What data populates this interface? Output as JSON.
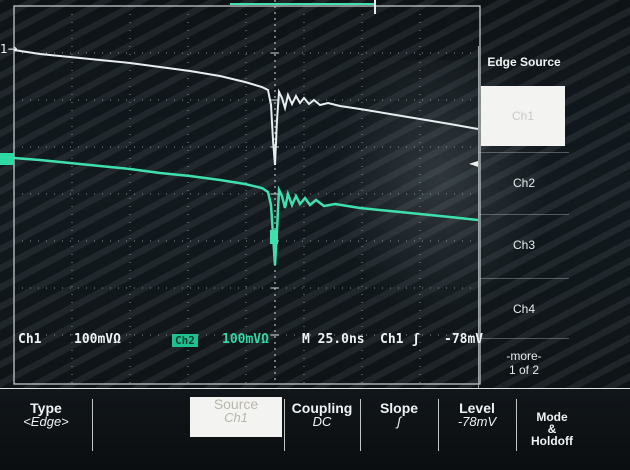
{
  "side_menu": {
    "header": "Edge Source",
    "buttons": [
      {
        "label": "Ch1",
        "active": true
      },
      {
        "label": "Ch2",
        "active": false
      },
      {
        "label": "Ch3",
        "active": false
      },
      {
        "label": "Ch4",
        "active": false
      }
    ],
    "more_line1": "-more-",
    "more_line2": "1 of 2"
  },
  "status": {
    "ch1_label": "Ch1",
    "ch1_scale": "100mVΩ",
    "ch2_badge": "Ch2",
    "ch2_scale": "100mVΩ",
    "timebase": "M 25.0ns",
    "trigger_channel": "Ch1",
    "trigger_slope_symbol": "ʃ",
    "trigger_level": "-78mV"
  },
  "bottom_menu": {
    "type_label": "Type",
    "type_value": "<Edge>",
    "source_label": "Source",
    "source_value": "Ch1",
    "coupling_label": "Coupling",
    "coupling_value": "DC",
    "slope_label": "Slope",
    "slope_value": "ʃ",
    "level_label": "Level",
    "level_value": "-78mV",
    "mode_line1": "Mode",
    "mode_line2": "&",
    "mode_line3": "Holdoff"
  },
  "markers": {
    "ch1_marker": "1→",
    "trigger_arrow": "◄"
  },
  "colors": {
    "ch1_trace": "#e8eef0",
    "ch2_trace": "#3fe0ae",
    "grid": "#9fb0b2"
  }
}
